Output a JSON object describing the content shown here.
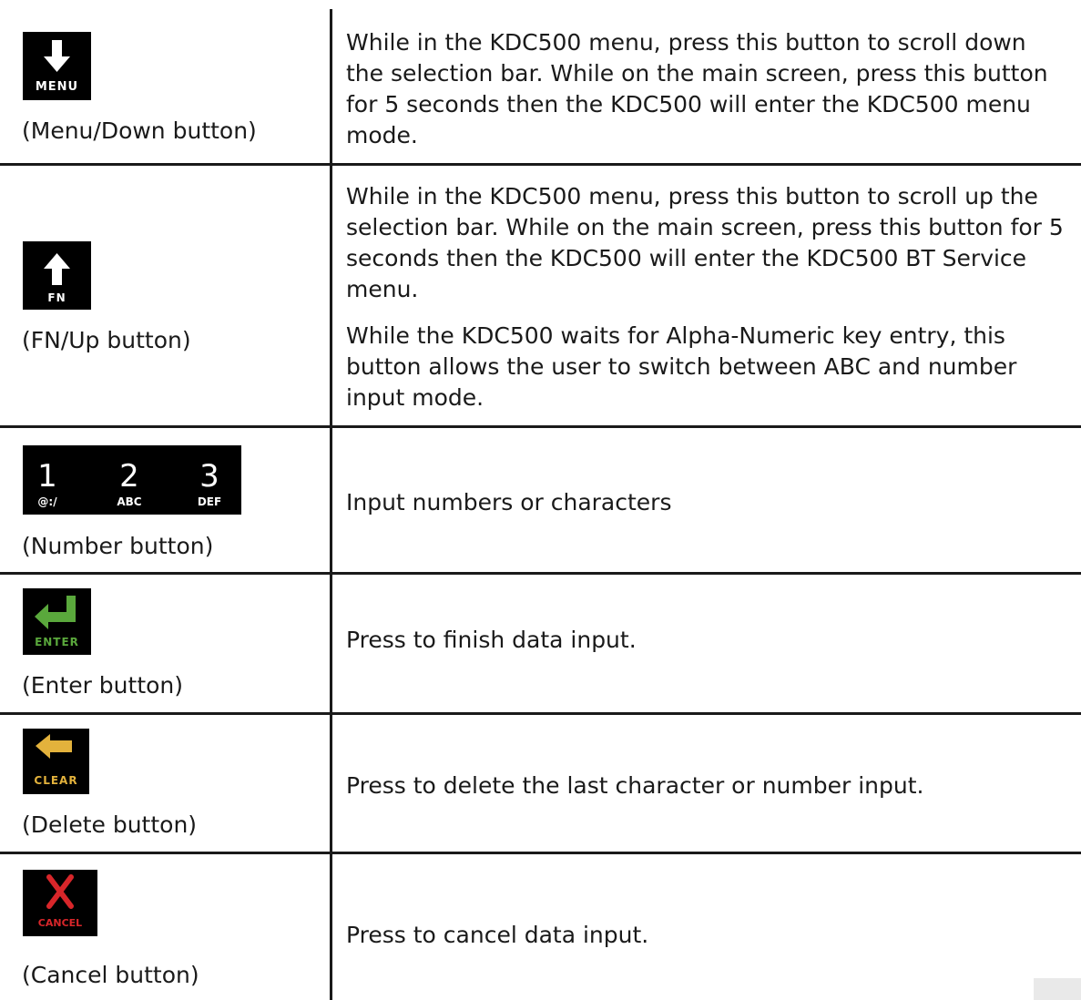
{
  "rows": [
    {
      "key_label": "MENU",
      "icon": "down-arrow-icon",
      "caption": "(Menu/Down button)",
      "desc": [
        "While in the KDC500 menu, press this button to scroll down the selection bar. While on the main screen, press this button for 5 seconds then the KDC500 will enter the KDC500 menu mode."
      ]
    },
    {
      "key_label": "FN",
      "icon": "up-arrow-icon",
      "caption": "(FN/Up button)",
      "desc": [
        "While in the KDC500 menu, press this button to scroll up the selection bar. While on the main screen, press this button for 5 seconds then the KDC500 will enter the KDC500 BT Service menu.",
        "While the KDC500 waits for Alpha-Numeric key entry, this button allows the user to switch between ABC and number input mode."
      ]
    },
    {
      "keys": [
        {
          "digit": "1",
          "sub": "@:/"
        },
        {
          "digit": "2",
          "sub": "ABC"
        },
        {
          "digit": "3",
          "sub": "DEF"
        }
      ],
      "caption": "(Number button)",
      "desc": [
        "Input numbers or characters"
      ]
    },
    {
      "key_label": "ENTER",
      "icon": "enter-arrow-icon",
      "color": "#5aa83c",
      "caption": "(Enter button)",
      "desc": [
        "Press to finish data input."
      ]
    },
    {
      "key_label": "CLEAR",
      "icon": "left-arrow-icon",
      "color": "#e3b23c",
      "caption": "(Delete button)",
      "desc": [
        "Press to delete the last character or number input."
      ]
    },
    {
      "key_label": "CANCEL",
      "icon": "x-icon",
      "color": "#d8262a",
      "caption": "(Cancel button)",
      "desc": [
        "Press to cancel data input."
      ]
    }
  ]
}
